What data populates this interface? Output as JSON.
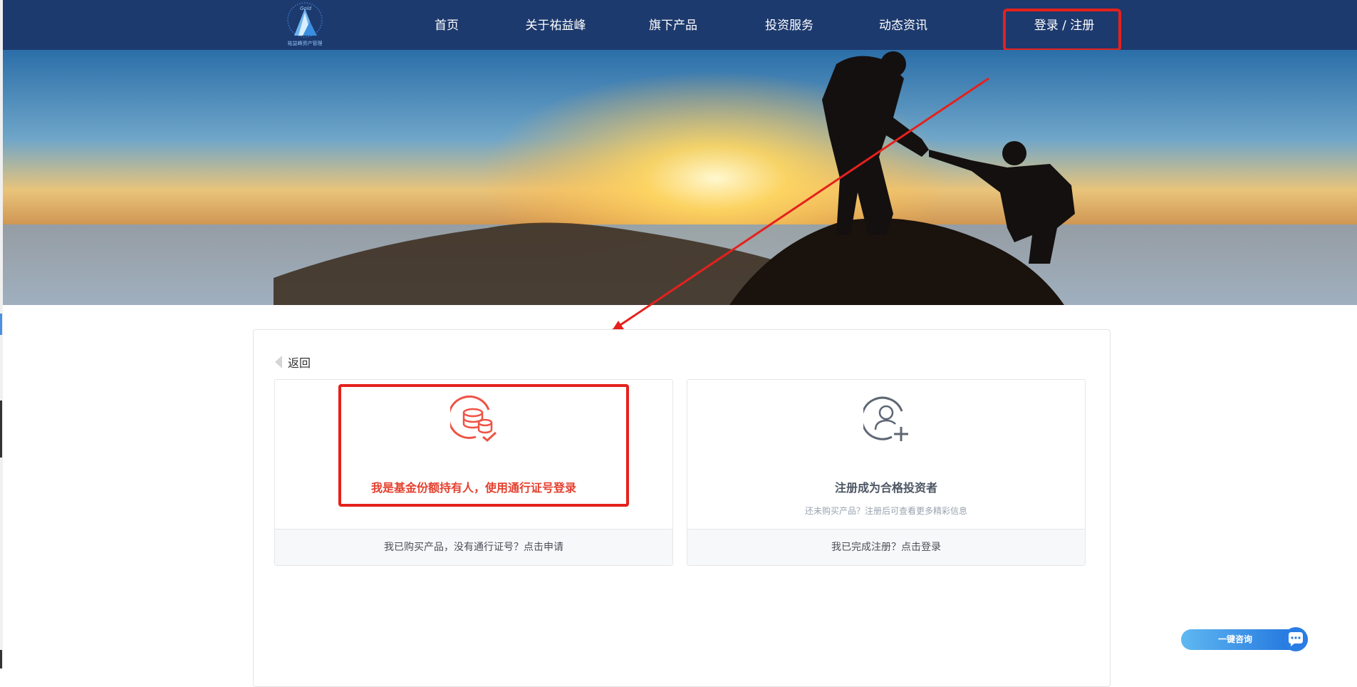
{
  "header": {
    "nav": [
      "首页",
      "关于祐益峰",
      "旗下产品",
      "投资服务",
      "动态资讯"
    ],
    "login_register": "登录 / 注册"
  },
  "colors": {
    "header_bg": "#1d3a6e",
    "accent_red": "#e5211c",
    "consult_blue": "#1c6fdc"
  },
  "back": {
    "label": "返回",
    "icon": "caret-left-icon"
  },
  "cards": {
    "holder": {
      "icon": "coins-check-icon",
      "title": "我是基金份额持有人，使用通行证号登录",
      "footer": "我已购买产品，没有通行证号？点击申请"
    },
    "register": {
      "icon": "user-plus-icon",
      "title": "注册成为合格投资者",
      "subtitle": "还未购买产品？注册后可查看更多精彩信息",
      "footer": "我已完成注册？点击登录"
    }
  },
  "consult": {
    "label": "一键咨询",
    "icon": "chat-bubble-icon"
  }
}
